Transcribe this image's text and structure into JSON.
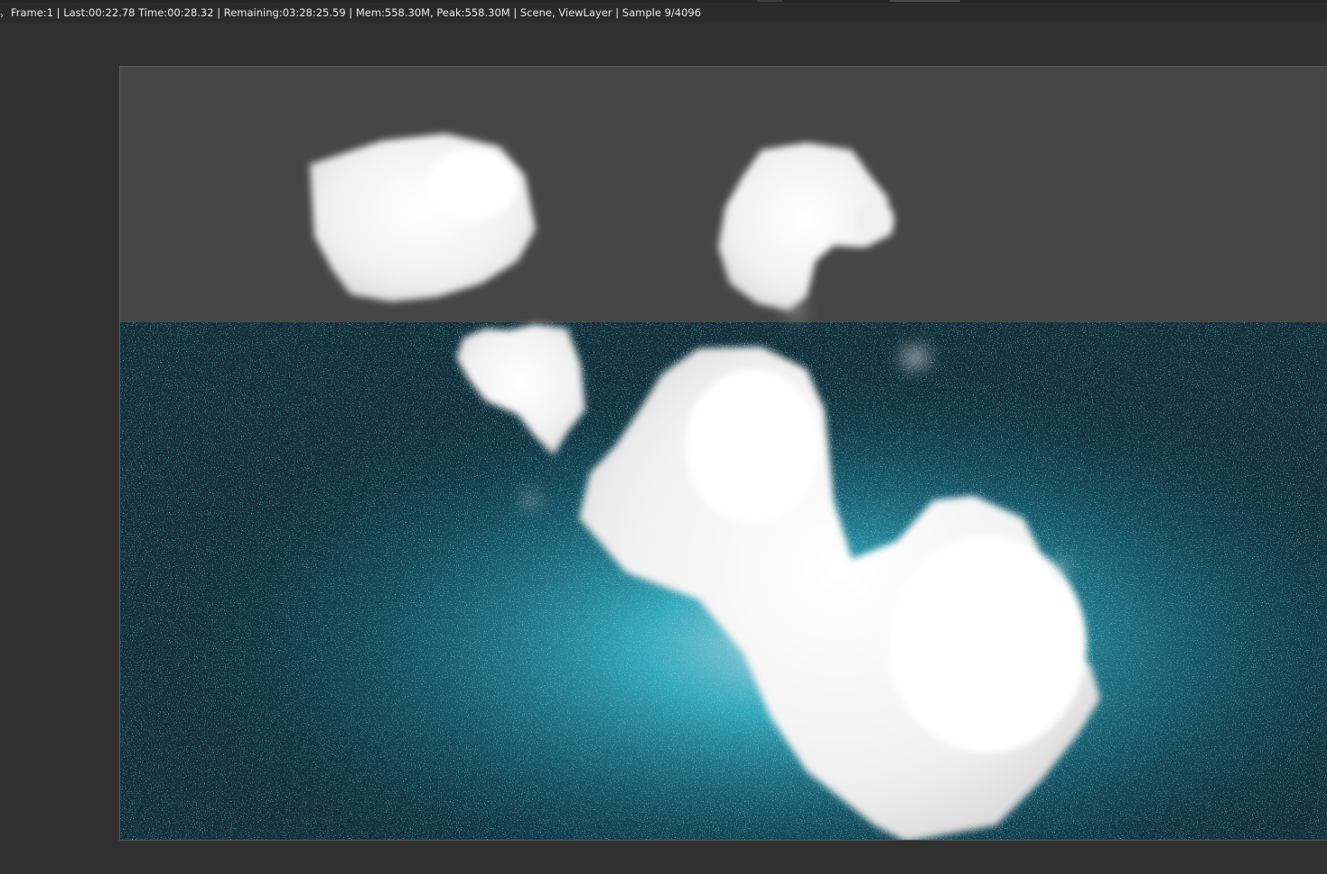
{
  "status": {
    "text": "Frame:1 | Last:00:22.78 Time:00:28.32 | Remaining:03:28:25.59 | Mem:558.30M, Peak:558.30M | Scene, ViewLayer | Sample 9/4096",
    "chevron": "›"
  },
  "render": {
    "background_gray": "#464646",
    "background_teal_dark": "#0f2f3a",
    "background_teal_mid": "#1b5f73",
    "glow_cyan": "#3fd0e6",
    "cloud_white": "#f6f6f6",
    "icon": "rendered-image"
  },
  "colors": {
    "app_bg": "#303030",
    "statusbar_bg": "#2b2b2b",
    "status_text": "#e8e8e8",
    "frame_border": "#5a5a5a"
  }
}
